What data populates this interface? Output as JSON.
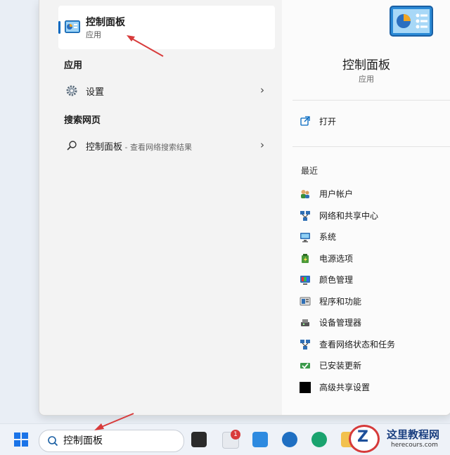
{
  "best_match": {
    "title": "控制面板",
    "subtitle": "应用",
    "icon": "control-panel-icon"
  },
  "sections": {
    "apps_label": "应用",
    "apps": [
      {
        "label": "设置",
        "icon": "gear-icon"
      }
    ],
    "web_label": "搜索网页",
    "web": [
      {
        "label": "控制面板",
        "suffix": " - 查看网络搜索结果",
        "icon": "search-icon"
      }
    ]
  },
  "detail": {
    "title": "控制面板",
    "subtitle": "应用",
    "open_label": "打开",
    "recent_label": "最近",
    "recent": [
      {
        "label": "用户帐户",
        "icon": "users-icon"
      },
      {
        "label": "网络和共享中心",
        "icon": "network-icon"
      },
      {
        "label": "系统",
        "icon": "system-icon"
      },
      {
        "label": "电源选项",
        "icon": "power-icon"
      },
      {
        "label": "颜色管理",
        "icon": "color-icon"
      },
      {
        "label": "程序和功能",
        "icon": "programs-icon"
      },
      {
        "label": "设备管理器",
        "icon": "device-manager-icon"
      },
      {
        "label": "查看网络状态和任务",
        "icon": "network-status-icon"
      },
      {
        "label": "已安装更新",
        "icon": "updates-icon"
      },
      {
        "label": "高级共享设置",
        "icon": "sharing-icon"
      }
    ]
  },
  "taskbar": {
    "search_value": "控制面板",
    "notification_count": "1"
  },
  "watermark": {
    "title": "这里教程网",
    "url": "herecours.com"
  },
  "colors": {
    "accent": "#0067c0",
    "annotation": "#d83b3b"
  }
}
